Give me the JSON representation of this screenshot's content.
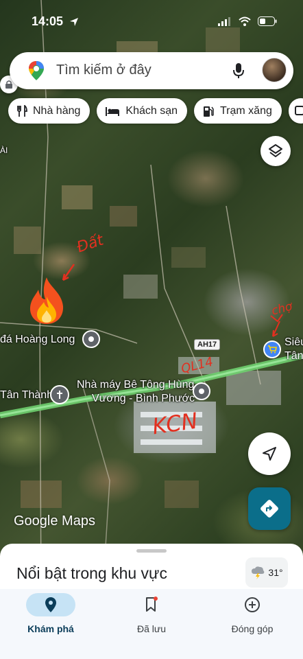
{
  "status_bar": {
    "time": "14:05"
  },
  "search": {
    "placeholder": "Tìm kiếm ở đây"
  },
  "chips": [
    {
      "label": "Nhà hàng",
      "icon": "restaurant-icon"
    },
    {
      "label": "Khách sạn",
      "icon": "hotel-icon"
    },
    {
      "label": "Trạm xăng",
      "icon": "gas-station-icon"
    }
  ],
  "map": {
    "places": {
      "hoang_long": "đá Hoàng Long",
      "tan_thanh": "Tân Thành",
      "factory_line1": "Nhà máy Bê Tông Hùng",
      "factory_line2": "Vương - Bình Phước",
      "sieu_line1": "Siêu",
      "sieu_line2": "Tân",
      "left_edge": "ÀI"
    },
    "road_shield": "AH17",
    "annotations": {
      "dat": "Đất",
      "ql14": "QL14",
      "kcn": "KCN",
      "cho": "chợ"
    },
    "attribution": "Google Maps"
  },
  "sheet": {
    "title": "Nổi bật trong khu vực",
    "weather_temp": "31°"
  },
  "nav": [
    {
      "label": "Khám phá",
      "active": true
    },
    {
      "label": "Đã lưu",
      "active": false
    },
    {
      "label": "Đóng góp",
      "active": false
    }
  ],
  "colors": {
    "accent": "#1a73e8",
    "directions_fab": "#0b6e8a",
    "highway": "#6fcf6f",
    "annotation": "#e23020"
  }
}
